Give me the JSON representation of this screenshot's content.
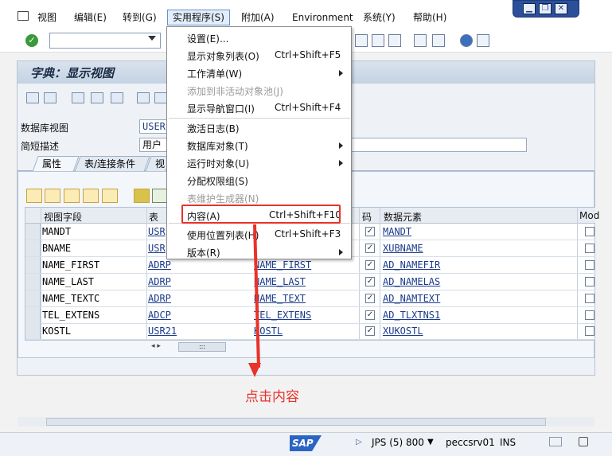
{
  "menubar": {
    "items": [
      "视图",
      "编辑(E)",
      "转到(G)",
      "实用程序(S)",
      "附加(A)",
      "Environment",
      "系统(Y)",
      "帮助(H)"
    ],
    "active_index": 3
  },
  "window_controls": {
    "minimize": "▁",
    "restore": "❐",
    "close": "✕"
  },
  "window": {
    "title": "字典：显示视图"
  },
  "fields": {
    "db_view_label": "数据库视图",
    "db_view_value": "USER",
    "short_desc_label": "简短描述",
    "short_desc_value": "用户"
  },
  "tabs": [
    "属性",
    "表/连接条件",
    "视"
  ],
  "grid": {
    "headers": [
      "视图字段",
      "表",
      "",
      "码",
      "数据元素",
      "Mod"
    ],
    "rows": [
      {
        "field": "MANDT",
        "table": "USR",
        "tfield": "",
        "key": true,
        "element": "MANDT"
      },
      {
        "field": "BNAME",
        "table": "USR",
        "tfield": "",
        "key": true,
        "element": "XUBNAME"
      },
      {
        "field": "NAME_FIRST",
        "table": "ADRP",
        "tfield": "NAME_FIRST",
        "key": true,
        "element": "AD_NAMEFIR"
      },
      {
        "field": "NAME_LAST",
        "table": "ADRP",
        "tfield": "NAME_LAST",
        "key": true,
        "element": "AD_NAMELAS"
      },
      {
        "field": "NAME_TEXTC",
        "table": "ADRP",
        "tfield": "NAME_TEXT",
        "key": true,
        "element": "AD_NAMTEXT"
      },
      {
        "field": "TEL_EXTENS",
        "table": "ADCP",
        "tfield": "TEL_EXTENS",
        "key": true,
        "element": "AD_TLXTNS1"
      },
      {
        "field": "KOSTL",
        "table": "USR21",
        "tfield": "KOSTL",
        "key": true,
        "element": "XUKOSTL"
      }
    ],
    "scroll_grip": ":::"
  },
  "context_menu": {
    "items": [
      {
        "label": "设置(E)...",
        "shortcut": "",
        "submenu": false,
        "disabled": false
      },
      {
        "label": "显示对象列表(O)",
        "shortcut": "Ctrl+Shift+F5",
        "submenu": false,
        "disabled": false
      },
      {
        "label": "工作清单(W)",
        "shortcut": "",
        "submenu": true,
        "disabled": false
      },
      {
        "label": "添加到非活动对象池(J)",
        "shortcut": "",
        "submenu": false,
        "disabled": true
      },
      {
        "label": "显示导航窗口(I)",
        "shortcut": "Ctrl+Shift+F4",
        "submenu": false,
        "disabled": false
      },
      {
        "label": "激活日志(B)",
        "shortcut": "",
        "submenu": false,
        "disabled": false
      },
      {
        "label": "数据库对象(T)",
        "shortcut": "",
        "submenu": true,
        "disabled": false
      },
      {
        "label": "运行时对象(U)",
        "shortcut": "",
        "submenu": true,
        "disabled": false
      },
      {
        "label": "分配权限组(S)",
        "shortcut": "",
        "submenu": false,
        "disabled": false
      },
      {
        "label": "表维护生成器(N)",
        "shortcut": "",
        "submenu": false,
        "disabled": true
      },
      {
        "label": "内容(A)",
        "shortcut": "Ctrl+Shift+F10",
        "submenu": false,
        "disabled": false
      },
      {
        "label": "使用位置列表(H)",
        "shortcut": "Ctrl+Shift+F3",
        "submenu": false,
        "disabled": false
      },
      {
        "label": "版本(R)",
        "shortcut": "",
        "submenu": true,
        "disabled": false
      }
    ],
    "highlighted_index": 10
  },
  "annotation": {
    "text": "点击内容",
    "color": "#e8322a"
  },
  "statusbar": {
    "logo": "SAP",
    "system": "JPS (5) 800",
    "server": "peccsrv01",
    "mode": "INS"
  },
  "colors": {
    "accent": "#e8322a",
    "header": "#c4d2e2",
    "link": "#1a3a8a"
  }
}
